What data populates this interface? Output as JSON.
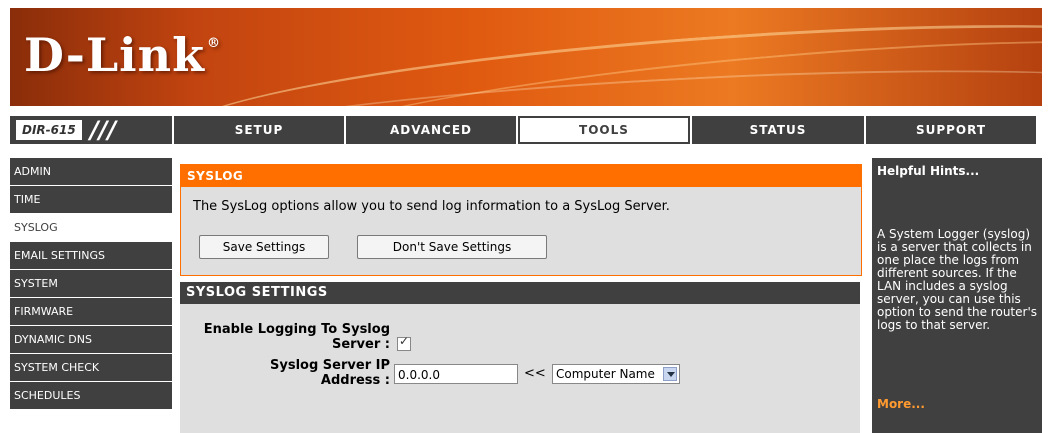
{
  "brand": {
    "logo_text": "D-Link",
    "registered_mark": "®"
  },
  "model": {
    "name": "DIR-615",
    "slashes": "///"
  },
  "tabs": [
    {
      "label": "SETUP"
    },
    {
      "label": "ADVANCED"
    },
    {
      "label": "TOOLS"
    },
    {
      "label": "STATUS"
    },
    {
      "label": "SUPPORT"
    }
  ],
  "active_tab": "TOOLS",
  "sidebar": {
    "items": [
      {
        "label": "ADMIN"
      },
      {
        "label": "TIME"
      },
      {
        "label": "SYSLOG"
      },
      {
        "label": "EMAIL SETTINGS"
      },
      {
        "label": "SYSTEM"
      },
      {
        "label": "FIRMWARE"
      },
      {
        "label": "DYNAMIC DNS"
      },
      {
        "label": "SYSTEM CHECK"
      },
      {
        "label": "SCHEDULES"
      }
    ],
    "active": "SYSLOG"
  },
  "syslog_box": {
    "title": "SYSLOG",
    "description": "The SysLog options allow you to send log information to a SysLog Server.",
    "save_label": "Save Settings",
    "dont_save_label": "Don't Save Settings"
  },
  "settings_box": {
    "title": "SYSLOG SETTINGS",
    "enable_label_line1": "Enable Logging To Syslog",
    "enable_label_line2": "Server :",
    "enable_checked": true,
    "ip_label_line1": "Syslog Server IP",
    "ip_label_line2": "Address :",
    "ip_value": "0.0.0.0",
    "arrows": "<<",
    "computer_select": "Computer Name"
  },
  "hints": {
    "title": "Helpful Hints...",
    "text": "A System Logger (syslog) is a server that collects in one place the logs from different sources. If the LAN includes a syslog server, you can use this option to send the router's logs to that server.",
    "more": "More..."
  },
  "colors": {
    "orange": "#ff6f00",
    "dark": "#404040",
    "panel": "#dfdfdf",
    "hint_link": "#ff9a30"
  }
}
